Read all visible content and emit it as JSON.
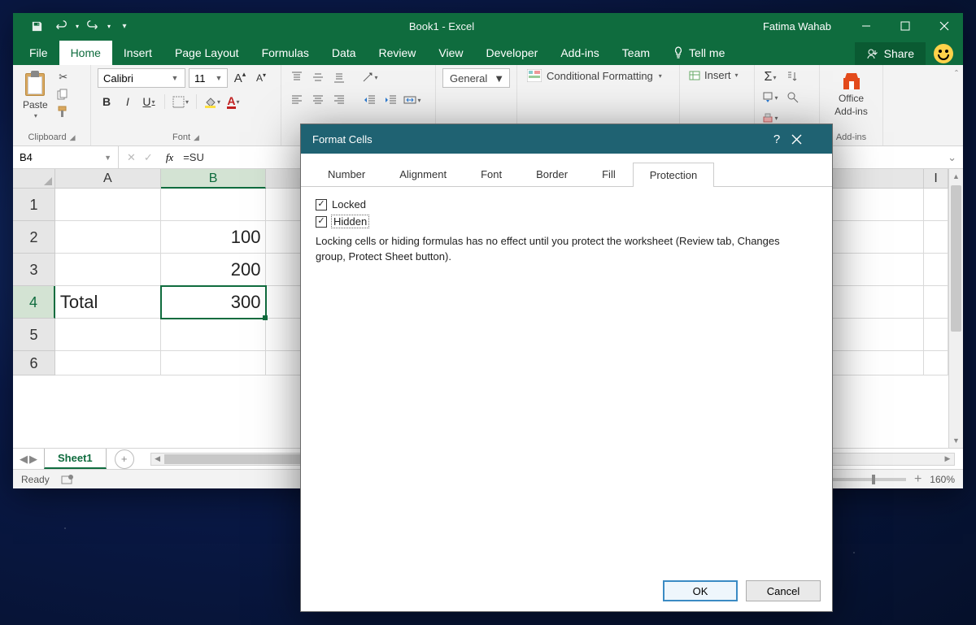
{
  "titlebar": {
    "doc_title": "Book1  -  Excel",
    "user": "Fatima Wahab"
  },
  "ribbon_tabs": {
    "file": "File",
    "home": "Home",
    "insert": "Insert",
    "page_layout": "Page Layout",
    "formulas": "Formulas",
    "data": "Data",
    "review": "Review",
    "view": "View",
    "developer": "Developer",
    "addins": "Add-ins",
    "team": "Team",
    "tell_me": "Tell me",
    "share": "Share"
  },
  "ribbon": {
    "clipboard": {
      "paste": "Paste",
      "label": "Clipboard"
    },
    "font": {
      "name": "Calibri",
      "size": "11",
      "label": "Font"
    },
    "number": {
      "format": "General"
    },
    "styles": {
      "cond_fmt": "Conditional Formatting",
      "insert": "Insert"
    },
    "addins": {
      "office": "Office",
      "addins": "Add-ins",
      "label": "Add-ins"
    }
  },
  "formula_bar": {
    "name_box": "B4",
    "fx": "fx",
    "formula": "=SU"
  },
  "grid": {
    "columns": [
      "A",
      "B",
      "I"
    ],
    "rows": [
      "1",
      "2",
      "3",
      "4",
      "5",
      "6"
    ],
    "cells": {
      "A4": "Total",
      "B2": "100",
      "B3": "200",
      "B4": "300"
    }
  },
  "sheet_tabs": {
    "sheet1": "Sheet1"
  },
  "statusbar": {
    "ready": "Ready",
    "zoom": "160%"
  },
  "dialog": {
    "title": "Format Cells",
    "tabs": {
      "number": "Number",
      "alignment": "Alignment",
      "font": "Font",
      "border": "Border",
      "fill": "Fill",
      "protection": "Protection"
    },
    "locked": {
      "label": "Locked",
      "checked": true
    },
    "hidden": {
      "label": "Hidden",
      "checked": true
    },
    "hint": "Locking cells or hiding formulas has no effect until you protect the worksheet (Review tab, Changes group, Protect Sheet button).",
    "ok": "OK",
    "cancel": "Cancel"
  }
}
